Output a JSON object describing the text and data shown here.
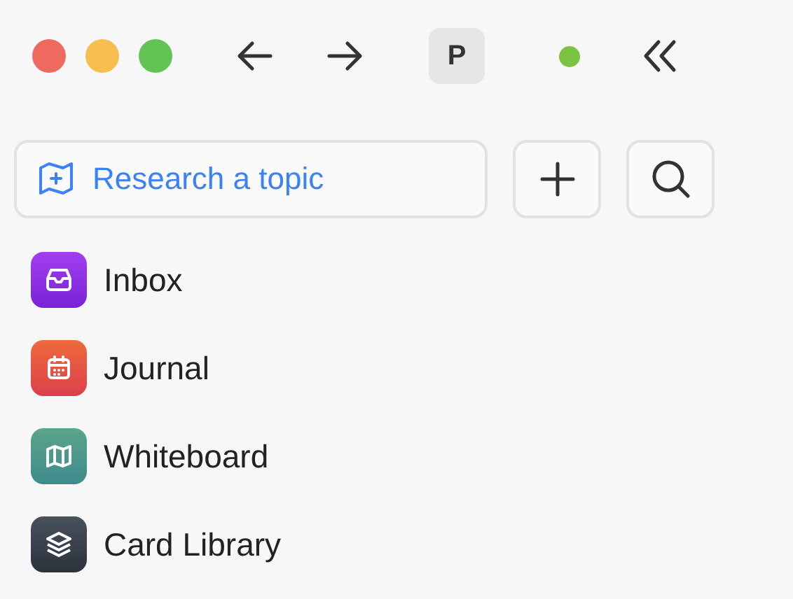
{
  "toolbar": {
    "profile_initial": "P"
  },
  "research_button": {
    "label": "Research a topic"
  },
  "nav_items": [
    {
      "label": "Inbox",
      "kind": "inbox"
    },
    {
      "label": "Journal",
      "kind": "journal"
    },
    {
      "label": "Whiteboard",
      "kind": "whiteboard"
    },
    {
      "label": "Card Library",
      "kind": "library"
    }
  ]
}
